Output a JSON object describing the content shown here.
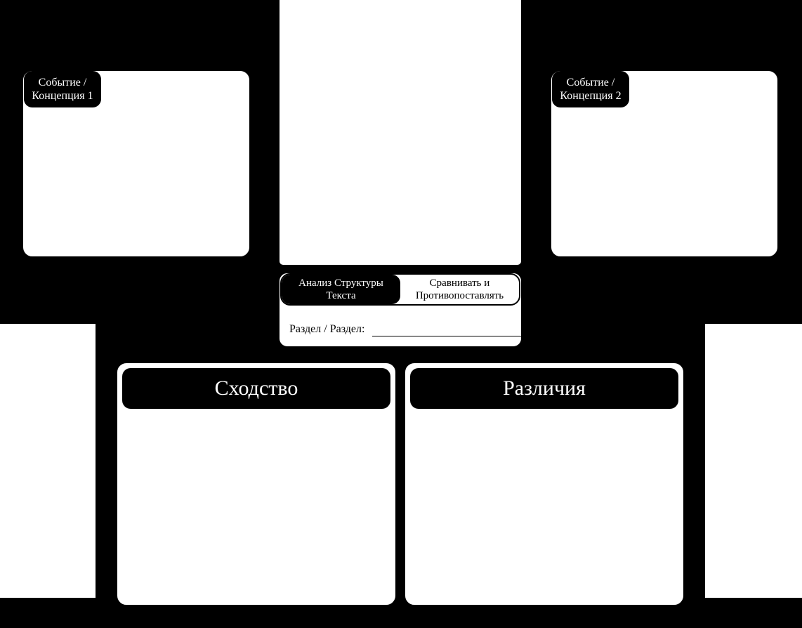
{
  "topLeft": {
    "label": "Событие / Концепция 1"
  },
  "topRight": {
    "label": "Событие / Концепция 2"
  },
  "center": {
    "tabLeft": "Анализ Структуры Текста",
    "tabRight": "Сравнивать и Противопоставлять",
    "sectionLabel": "Раздел / Раздел:"
  },
  "bottomLeft": {
    "header": "Сходство"
  },
  "bottomRight": {
    "header": "Различия"
  }
}
